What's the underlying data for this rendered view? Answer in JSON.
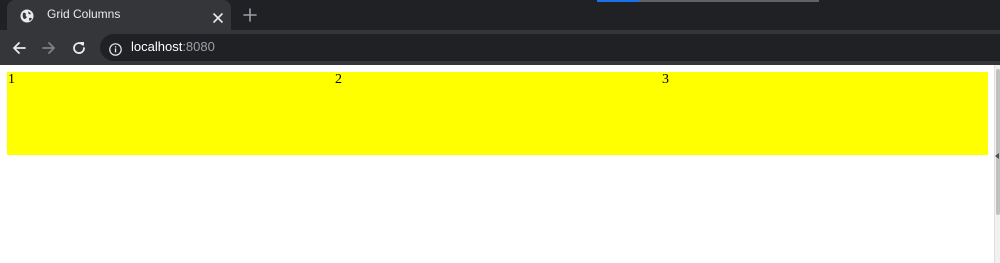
{
  "browser": {
    "tab": {
      "title": "Grid Columns",
      "favicon": "globe-icon"
    },
    "address_bar": {
      "host": "localhost",
      "port": ":8080"
    },
    "icons": {
      "back": "arrow-left-icon",
      "forward": "arrow-right-icon",
      "reload": "reload-icon",
      "site_info": "info-icon",
      "close_tab": "close-icon",
      "new_tab": "plus-icon"
    },
    "colors": {
      "tabstrip": "#202124",
      "toolbar": "#35363a",
      "omnibox": "#202124"
    }
  },
  "page": {
    "grid": {
      "background": "#ffff00",
      "cells": [
        "1",
        "2",
        "3"
      ]
    }
  }
}
